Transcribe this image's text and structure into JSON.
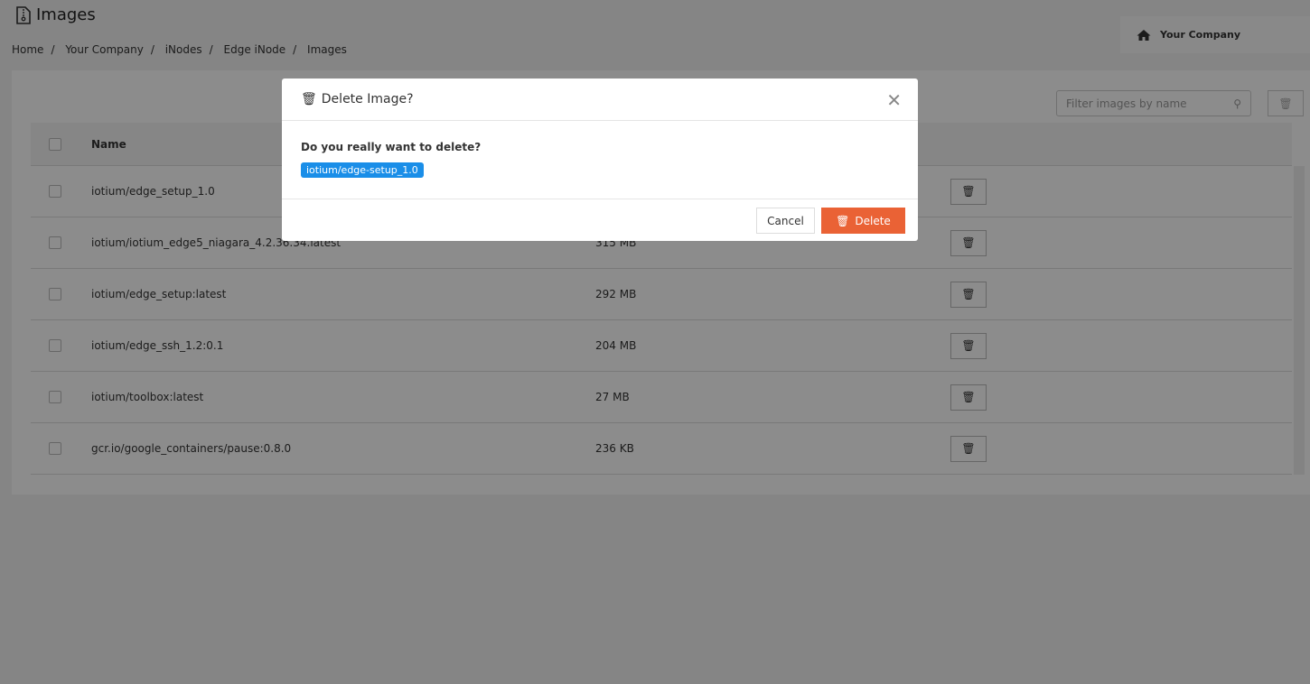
{
  "page": {
    "title": "Images",
    "icon": "file-archive-icon"
  },
  "breadcrumb": [
    "Home",
    "Your Company",
    "iNodes",
    "Edge iNode",
    "Images"
  ],
  "company": {
    "label": "Your Company",
    "icon": "home-icon"
  },
  "filter": {
    "placeholder": "Filter images by name"
  },
  "table": {
    "headers": {
      "name": "Name"
    },
    "rows": [
      {
        "name": "iotium/edge_setup_1.0",
        "size": ""
      },
      {
        "name": "iotium/iotium_edge5_niagara_4.2.36.34.latest",
        "size": "315 MB"
      },
      {
        "name": "iotium/edge_setup:latest",
        "size": "292 MB"
      },
      {
        "name": "iotium/edge_ssh_1.2:0.1",
        "size": "204 MB"
      },
      {
        "name": "iotium/toolbox:latest",
        "size": "27 MB"
      },
      {
        "name": "gcr.io/google_containers/pause:0.8.0",
        "size": "236 KB"
      }
    ]
  },
  "modal": {
    "title": "Delete Image?",
    "question": "Do you really want to delete?",
    "item": "iotium/edge-setup_1.0",
    "cancel": "Cancel",
    "delete": "Delete",
    "delete_color": "#ea6235",
    "tag_color": "#1a8ee8"
  }
}
